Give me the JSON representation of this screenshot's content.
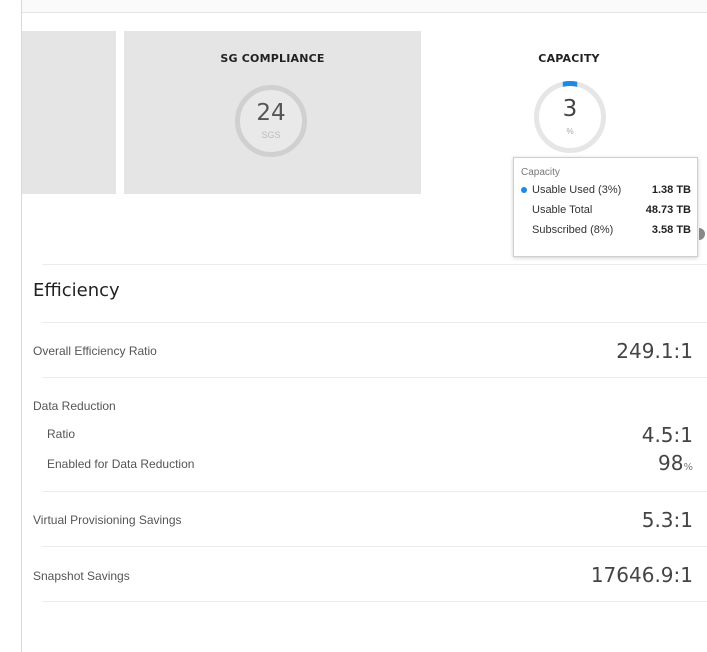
{
  "tiles": {
    "sg_compliance": {
      "title": "SG COMPLIANCE",
      "value": "24",
      "unit": "SGS"
    },
    "capacity": {
      "title": "CAPACITY",
      "value": "3",
      "unit": "%",
      "percent_used": 3,
      "accent_color": "#1e88e5"
    }
  },
  "tooltip": {
    "title": "Capacity",
    "rows": [
      {
        "label": "Usable Used (3%)",
        "value": "1.38 TB",
        "dot_color": "#1e88e5"
      },
      {
        "label": "Usable Total",
        "value": "48.73 TB"
      },
      {
        "label": "Subscribed (8%)",
        "value": "3.58 TB"
      }
    ]
  },
  "efficiency": {
    "title": "Efficiency",
    "overall": {
      "label": "Overall Efficiency Ratio",
      "value": "249.1:1"
    },
    "data_reduction": {
      "label": "Data Reduction",
      "ratio_label": "Ratio",
      "ratio_value": "4.5:1",
      "enabled_label": "Enabled for Data Reduction",
      "enabled_value": "98",
      "enabled_unit": "%"
    },
    "virtual_provisioning": {
      "label": "Virtual Provisioning Savings",
      "value": "5.3:1"
    },
    "snapshot": {
      "label": "Snapshot Savings",
      "value": "17646.9:1"
    }
  }
}
